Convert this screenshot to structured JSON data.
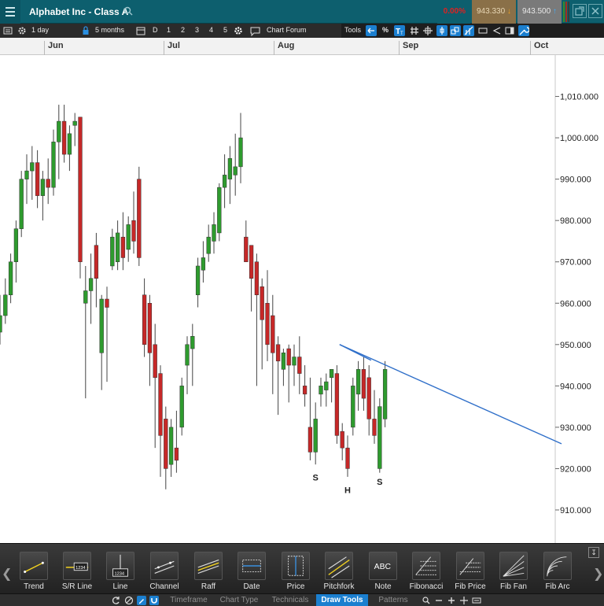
{
  "header": {
    "title": "Alphabet Inc - Class A",
    "change": "0.00%",
    "bid": "943.330",
    "ask": "943.500"
  },
  "toolbar": {
    "interval": "1 day",
    "range": "5 months",
    "periods": [
      "D",
      "1",
      "2",
      "3",
      "4",
      "5"
    ],
    "forum": "Chart Forum",
    "tools_label": "Tools",
    "percent": "%"
  },
  "date_axis": {
    "months": [
      "Jun",
      "Jul",
      "Aug",
      "Sep",
      "Oct"
    ]
  },
  "chart_data": {
    "type": "candlestick",
    "price_axis": {
      "ylim": [
        902,
        1020
      ],
      "ticks": [
        910,
        920,
        930,
        940,
        950,
        960,
        970,
        980,
        990,
        1000,
        1010
      ],
      "tick_labels": [
        "910.000",
        "920.000",
        "930.000",
        "940.000",
        "950.000",
        "960.000",
        "970.000",
        "980.000",
        "990.000",
        "1,000.000",
        "1,010.000"
      ]
    },
    "up_color": "#2e9b2e",
    "down_color": "#c62828",
    "candles": [
      {
        "o": 953,
        "h": 962,
        "l": 950,
        "c": 957
      },
      {
        "o": 957,
        "h": 966,
        "l": 955,
        "c": 962
      },
      {
        "o": 962,
        "h": 972,
        "l": 960,
        "c": 970
      },
      {
        "o": 970,
        "h": 980,
        "l": 965,
        "c": 978
      },
      {
        "o": 978,
        "h": 992,
        "l": 976,
        "c": 990
      },
      {
        "o": 990,
        "h": 996,
        "l": 984,
        "c": 992
      },
      {
        "o": 992,
        "h": 998,
        "l": 985,
        "c": 994
      },
      {
        "o": 994,
        "h": 997,
        "l": 983,
        "c": 986
      },
      {
        "o": 986,
        "h": 992,
        "l": 980,
        "c": 990
      },
      {
        "o": 990,
        "h": 995,
        "l": 984,
        "c": 988
      },
      {
        "o": 988,
        "h": 1002,
        "l": 986,
        "c": 999
      },
      {
        "o": 999,
        "h": 1008,
        "l": 990,
        "c": 1004
      },
      {
        "o": 1004,
        "h": 1008,
        "l": 994,
        "c": 996
      },
      {
        "o": 996,
        "h": 1003,
        "l": 992,
        "c": 1001
      },
      {
        "o": 1003,
        "h": 1006,
        "l": 998,
        "c": 1004
      },
      {
        "o": 1005,
        "h": 1005,
        "l": 966,
        "c": 970
      },
      {
        "o": 960,
        "h": 969,
        "l": 937,
        "c": 963
      },
      {
        "o": 963,
        "h": 972,
        "l": 955,
        "c": 966
      },
      {
        "o": 974,
        "h": 977,
        "l": 959,
        "c": 966
      },
      {
        "o": 948,
        "h": 962,
        "l": 939,
        "c": 961
      },
      {
        "o": 961,
        "h": 964,
        "l": 941,
        "c": 959
      },
      {
        "o": 969,
        "h": 978,
        "l": 968,
        "c": 976
      },
      {
        "o": 970,
        "h": 980,
        "l": 968,
        "c": 977
      },
      {
        "o": 976,
        "h": 982,
        "l": 968,
        "c": 971
      },
      {
        "o": 973,
        "h": 981,
        "l": 970,
        "c": 979
      },
      {
        "o": 980,
        "h": 987,
        "l": 972,
        "c": 975
      },
      {
        "o": 990,
        "h": 993,
        "l": 969,
        "c": 971
      },
      {
        "o": 962,
        "h": 966,
        "l": 947,
        "c": 950
      },
      {
        "o": 960,
        "h": 962,
        "l": 940,
        "c": 948
      },
      {
        "o": 950,
        "h": 955,
        "l": 925,
        "c": 942
      },
      {
        "o": 943,
        "h": 945,
        "l": 918,
        "c": 928
      },
      {
        "o": 932,
        "h": 935,
        "l": 915,
        "c": 920
      },
      {
        "o": 921,
        "h": 932,
        "l": 918,
        "c": 930
      },
      {
        "o": 925,
        "h": 934,
        "l": 919,
        "c": 922
      },
      {
        "o": 930,
        "h": 942,
        "l": 928,
        "c": 940
      },
      {
        "o": 945,
        "h": 952,
        "l": 938,
        "c": 950
      },
      {
        "o": 949,
        "h": 955,
        "l": 940,
        "c": 952
      },
      {
        "o": 962,
        "h": 971,
        "l": 959,
        "c": 969
      },
      {
        "o": 968,
        "h": 975,
        "l": 965,
        "c": 971
      },
      {
        "o": 972,
        "h": 979,
        "l": 970,
        "c": 976
      },
      {
        "o": 975,
        "h": 982,
        "l": 972,
        "c": 979
      },
      {
        "o": 977,
        "h": 989,
        "l": 975,
        "c": 988
      },
      {
        "o": 988,
        "h": 996,
        "l": 983,
        "c": 991
      },
      {
        "o": 990,
        "h": 998,
        "l": 984,
        "c": 995
      },
      {
        "o": 991,
        "h": 1001,
        "l": 986,
        "c": 993
      },
      {
        "o": 993,
        "h": 1006,
        "l": 989,
        "c": 1000
      },
      {
        "o": 976,
        "h": 980,
        "l": 970,
        "c": 970
      },
      {
        "o": 974,
        "h": 974,
        "l": 958,
        "c": 966
      },
      {
        "o": 970,
        "h": 972,
        "l": 940,
        "c": 962
      },
      {
        "o": 964,
        "h": 966,
        "l": 944,
        "c": 956
      },
      {
        "o": 960,
        "h": 968,
        "l": 946,
        "c": 950
      },
      {
        "o": 957,
        "h": 962,
        "l": 938,
        "c": 948
      },
      {
        "o": 950,
        "h": 952,
        "l": 933,
        "c": 946
      },
      {
        "o": 944,
        "h": 949,
        "l": 940,
        "c": 948
      },
      {
        "o": 949,
        "h": 950,
        "l": 936,
        "c": 945
      },
      {
        "o": 945,
        "h": 950,
        "l": 940,
        "c": 947
      },
      {
        "o": 947,
        "h": 952,
        "l": 938,
        "c": 943
      },
      {
        "o": 940,
        "h": 945,
        "l": 935,
        "c": 938
      },
      {
        "o": 930,
        "h": 942,
        "l": 922,
        "c": 924
      },
      {
        "o": 924,
        "h": 936,
        "l": 921,
        "c": 932
      },
      {
        "o": 938,
        "h": 942,
        "l": 935,
        "c": 940
      },
      {
        "o": 939,
        "h": 943,
        "l": 935,
        "c": 941
      },
      {
        "o": 942,
        "h": 944,
        "l": 936,
        "c": 944
      },
      {
        "o": 943,
        "h": 945,
        "l": 926,
        "c": 928
      },
      {
        "o": 929,
        "h": 931,
        "l": 922,
        "c": 925
      },
      {
        "o": 925,
        "h": 928,
        "l": 918,
        "c": 920
      },
      {
        "o": 930,
        "h": 942,
        "l": 928,
        "c": 940
      },
      {
        "o": 938,
        "h": 946,
        "l": 934,
        "c": 944
      },
      {
        "o": 944,
        "h": 947,
        "l": 934,
        "c": 937
      },
      {
        "o": 942,
        "h": 945,
        "l": 928,
        "c": 932
      },
      {
        "o": 932,
        "h": 939,
        "l": 926,
        "c": 928
      },
      {
        "o": 920,
        "h": 937,
        "l": 919,
        "c": 935
      },
      {
        "o": 932,
        "h": 946,
        "l": 930,
        "c": 944
      }
    ],
    "trendline": {
      "from": {
        "index": 63.5,
        "price": 950
      },
      "to": {
        "index": 105,
        "price": 926
      }
    },
    "annotations": [
      {
        "text": "S",
        "index": 59,
        "price": 919
      },
      {
        "text": "H",
        "index": 65,
        "price": 916
      },
      {
        "text": "S",
        "index": 71,
        "price": 918
      }
    ]
  },
  "draw_tools": [
    {
      "label": "Trend",
      "icon": "trend-icon"
    },
    {
      "label": "S/R Line",
      "icon": "sr-line-icon",
      "badge": "1234"
    },
    {
      "label": "Line",
      "icon": "line-icon",
      "badge": "1234"
    },
    {
      "label": "Channel",
      "icon": "channel-icon"
    },
    {
      "label": "Raff",
      "icon": "raff-icon"
    },
    {
      "label": "Date",
      "icon": "date-icon"
    },
    {
      "label": "Price",
      "icon": "price-icon"
    },
    {
      "label": "Pitchfork",
      "icon": "pitchfork-icon"
    },
    {
      "label": "Note",
      "icon": "note-icon",
      "badge": "ABC"
    },
    {
      "label": "Fibonacci",
      "icon": "fibonacci-icon"
    },
    {
      "label": "Fib Price",
      "icon": "fib-price-icon"
    },
    {
      "label": "Fib Fan",
      "icon": "fib-fan-icon"
    },
    {
      "label": "Fib Arc",
      "icon": "fib-arc-icon"
    }
  ],
  "tabs": [
    {
      "label": "Timeframe",
      "active": false
    },
    {
      "label": "Chart Type",
      "active": false
    },
    {
      "label": "Technicals",
      "active": false
    },
    {
      "label": "Draw Tools",
      "active": true
    },
    {
      "label": "Patterns",
      "active": false
    }
  ]
}
